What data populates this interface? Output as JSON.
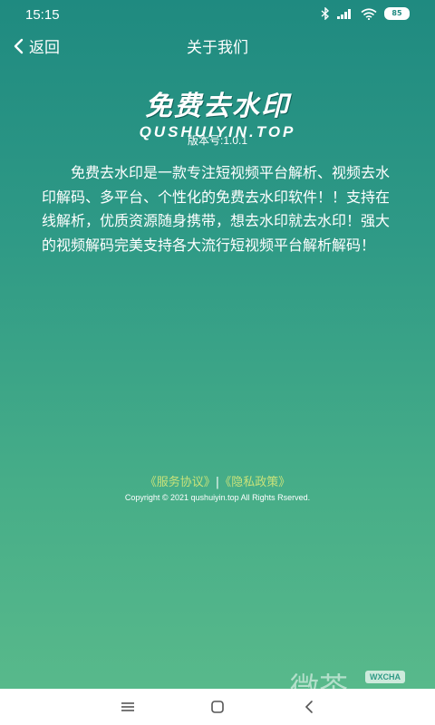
{
  "status": {
    "time": "15:15",
    "battery": "85"
  },
  "header": {
    "back_label": "返回",
    "title": "关于我们"
  },
  "logo": {
    "name_cn": "免费去水印",
    "name_en": "QUSHUIYIN.TOP"
  },
  "version": "版本号:1.0.1",
  "description": "免费去水印是一款专注短视频平台解析、视频去水印解码、多平台、个性化的免费去水印软件！！支持在线解析，优质资源随身携带，想去水印就去水印！强大的视频解码完美支持各大流行短视频平台解析解码！",
  "footer": {
    "service_link": "《服务协议》",
    "separator": "|",
    "privacy_link": "《隐私政策》",
    "copyright": "Copyright © 2021 qushuiyin.top All Rights Rserved."
  },
  "watermark": {
    "text": "微茶",
    "badge": "WXCHA"
  },
  "colors": {
    "gradient_top": "#1f8a80",
    "gradient_bottom": "#58b98b",
    "link": "#c8e27a"
  }
}
